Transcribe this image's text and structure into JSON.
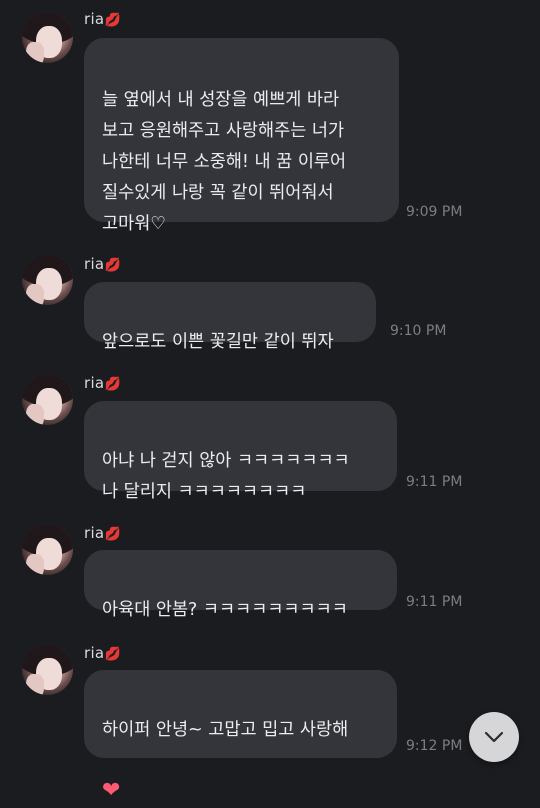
{
  "messages": [
    {
      "sender": "ria",
      "emoji": "💋",
      "text": "늘 옆에서 내 성장을 예쁘게 바라\n보고 응원해주고 사랑해주는 너가\n나한테 너무 소중해! 내 꿈 이루어\n질수있게 나랑 꼭 같이 뛰어줘서\n고마워♡",
      "time": "9:09 PM"
    },
    {
      "sender": "ria",
      "emoji": "💋",
      "text": "앞으로도 이쁜 꽃길만 같이 뛰자",
      "time": "9:10 PM"
    },
    {
      "sender": "ria",
      "emoji": "💋",
      "text": "아냐 나 걷지 않아 ㅋㅋㅋㅋㅋㅋㅋ\n나 달리지 ㅋㅋㅋㅋㅋㅋㅋㅋ",
      "time": "9:11 PM"
    },
    {
      "sender": "ria",
      "emoji": "💋",
      "text": "아육대 안봄? ㅋㅋㅋㅋㅋㅋㅋㅋㅋ",
      "time": "9:11 PM"
    },
    {
      "sender": "ria",
      "emoji": "💋",
      "text": "하이퍼 안녕~ 고맙고 밉고 사랑해",
      "trailing_emoji": "❤",
      "time": "9:12 PM"
    }
  ],
  "scroll_button_icon": "chevron-down-icon",
  "colors": {
    "background": "#1b1c20",
    "bubble": "#34353b",
    "text": "#ececee",
    "time": "#7b7d83",
    "heart": "#ff5a72"
  }
}
